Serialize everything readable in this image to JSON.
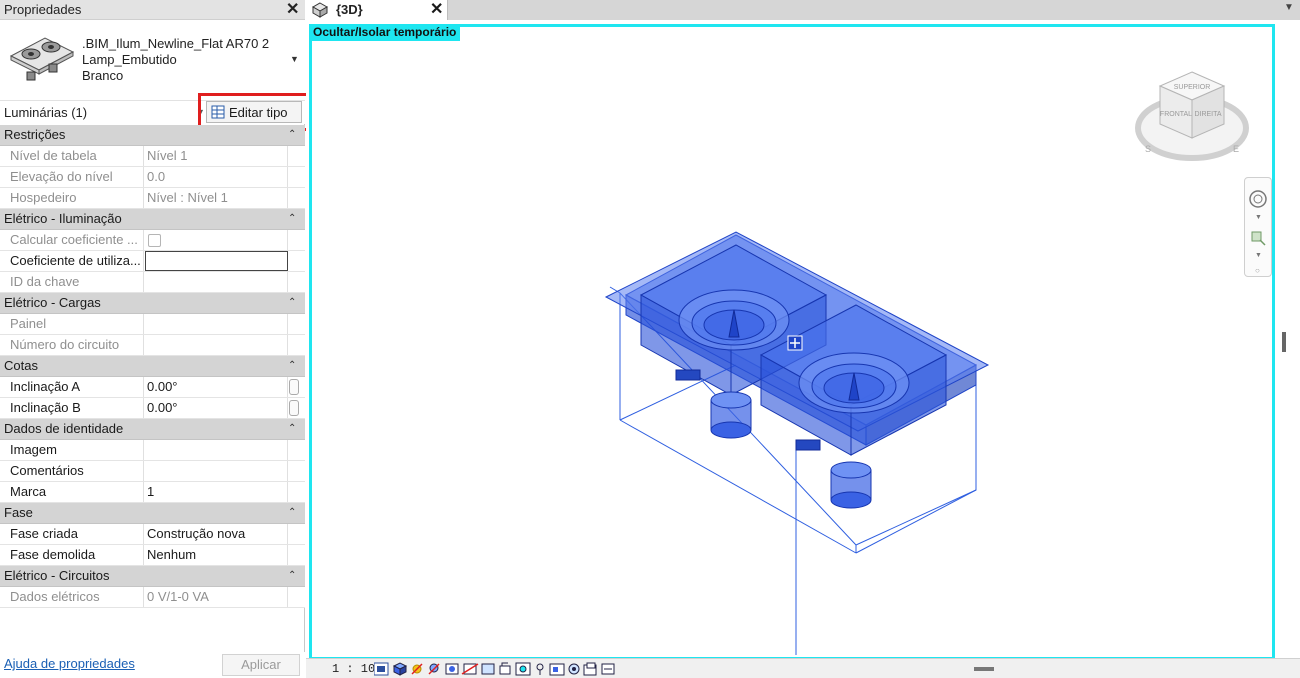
{
  "properties": {
    "title": "Propriedades",
    "type_name_lines": [
      ".BIM_Ilum_Newline_Flat AR70 2",
      "Lamp_Embutido",
      "Branco"
    ],
    "instance_filter": "Luminárias (1)",
    "edit_type_label": "Editar tipo",
    "groups": [
      {
        "title": "Restrições",
        "rows": [
          {
            "k": "Nível de tabela",
            "v": "Nível 1"
          },
          {
            "k": "Elevação do nível",
            "v": "0.0"
          },
          {
            "k": "Hospedeiro",
            "v": "Nível : Nível 1"
          }
        ]
      },
      {
        "title": "Elétrico - Iluminação",
        "rows": [
          {
            "k": "Calcular coeficiente ...",
            "v": ""
          },
          {
            "k": "Coeficiente de utiliza...",
            "v": ""
          },
          {
            "k": "ID da chave",
            "v": ""
          }
        ]
      },
      {
        "title": "Elétrico - Cargas",
        "rows": [
          {
            "k": "Painel",
            "v": ""
          },
          {
            "k": "Número do circuito",
            "v": ""
          }
        ]
      },
      {
        "title": "Cotas",
        "rows": [
          {
            "k": "Inclinação A",
            "v": "0.00°"
          },
          {
            "k": "Inclinação B",
            "v": "0.00°"
          }
        ]
      },
      {
        "title": "Dados de identidade",
        "rows": [
          {
            "k": "Imagem",
            "v": ""
          },
          {
            "k": "Comentários",
            "v": ""
          },
          {
            "k": "Marca",
            "v": "1"
          }
        ]
      },
      {
        "title": "Fase",
        "rows": [
          {
            "k": "Fase criada",
            "v": "Construção nova"
          },
          {
            "k": "Fase demolida",
            "v": "Nenhum"
          }
        ]
      },
      {
        "title": "Elétrico - Circuitos",
        "rows": [
          {
            "k": "Dados elétricos",
            "v": "0 V/1-0 VA"
          }
        ]
      }
    ],
    "help_link": "Ajuda de propriedades",
    "apply_label": "Aplicar"
  },
  "view": {
    "tab_label": "{3D}",
    "mode_label": "Ocultar/Isolar temporário",
    "viewcube": {
      "top": "SUPERIOR",
      "front": "FRONTAL",
      "right": "DIREITA",
      "south": "S",
      "east": "E"
    },
    "scale": "1 : 100"
  },
  "colors": {
    "isolate_border": "#1ee6f0",
    "highlight": "#e01e1e",
    "selection": "#2f5fe0"
  }
}
